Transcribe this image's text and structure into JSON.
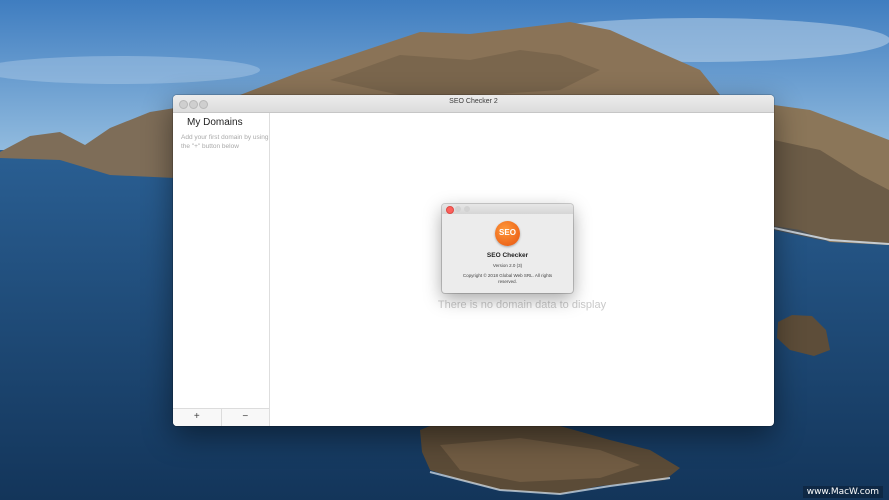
{
  "main_window": {
    "title": "SEO Checker 2",
    "sidebar": {
      "title": "My Domains",
      "hint": "Add your first domain by using the \"+\" button below",
      "add_button": "+",
      "remove_button": "−"
    },
    "empty_message": "There is no domain data to display"
  },
  "about_dialog": {
    "logo_text": "SEO",
    "app_name": "SEO Checker",
    "version": "Version 2.0 (3)",
    "copyright": "Copyright © 2018 Global Web SRL. All rights reserved."
  },
  "watermark": "www.MacW.com",
  "colors": {
    "accent_orange": "#e6520d",
    "close_red": "#fc605c"
  }
}
